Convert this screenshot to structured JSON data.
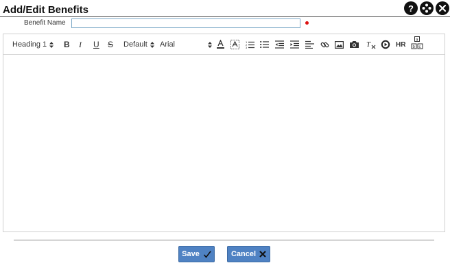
{
  "dialog": {
    "title": "Add/Edit Benefits",
    "icons": [
      "help-icon",
      "move-icon",
      "close-icon"
    ]
  },
  "form": {
    "benefit_name_label": "Benefit Name",
    "benefit_name_value": "",
    "required_color": "#dd1111"
  },
  "toolbar": {
    "heading_value": "Heading 1",
    "size_value": "Default",
    "font_value": "Arial",
    "hr_label": "HR"
  },
  "footer": {
    "save_label": "Save",
    "cancel_label": "Cancel",
    "accent": "#4f82c3"
  }
}
